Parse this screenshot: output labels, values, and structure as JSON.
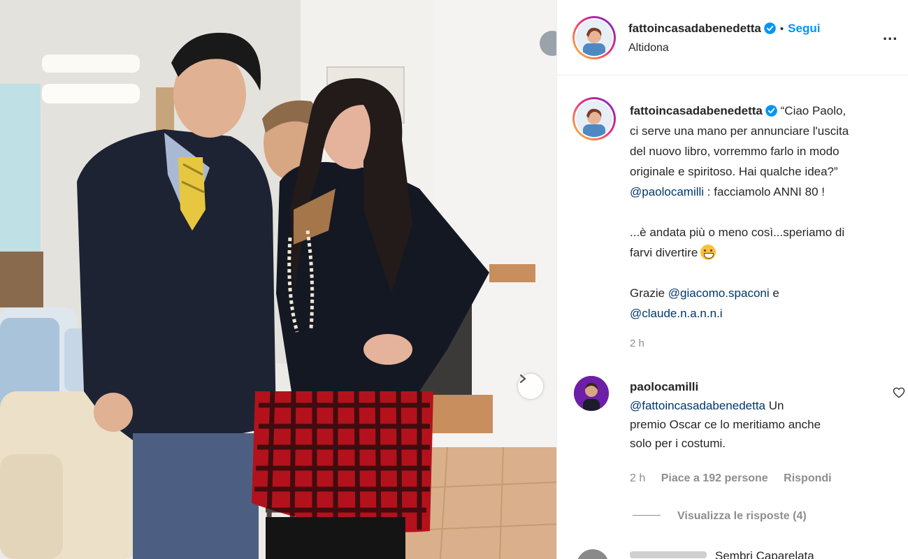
{
  "post": {
    "author": "fattoincasadabenedetta",
    "follow_label": "Segui",
    "separator": "•",
    "location": "Altidona",
    "more_label": "...",
    "next_photo_icon": "chevron-right-icon"
  },
  "caption": {
    "author": "fattoincasadabenedetta",
    "lines": [
      "“Ciao Paolo,",
      "ci serve una mano per annunciare l'uscita",
      "del nuovo libro, vorremmo farlo in modo",
      "originale e spiritoso. Hai qualche idea?”",
      " : facciamolo ANNI 80 !",
      "...è andata più o meno così...speriamo di",
      "farvi divertire",
      "Grazie ",
      " e"
    ],
    "mention_paolo": "@paolocamilli",
    "mention_giacomo": "@giacomo.spaconi",
    "mention_claude": "@claude.n.a.n.n.i",
    "timestamp": "2 h"
  },
  "comment": {
    "user": "paolocamilli",
    "mention": "@fattoincasadabenedetta",
    "lines": [
      " Un",
      "premio Oscar ce lo meritiamo anche",
      "solo per i costumi."
    ],
    "time": "2 h",
    "likes": "Piace a 192 persone",
    "reply_label": "Rispondi",
    "view_replies": "Visualizza le risposte (4)"
  },
  "next_comment": {
    "text": "Sembri Caparelata"
  },
  "colors": {
    "accent": "#0095f6",
    "mention": "#00376b",
    "muted": "#8e8e8e"
  }
}
